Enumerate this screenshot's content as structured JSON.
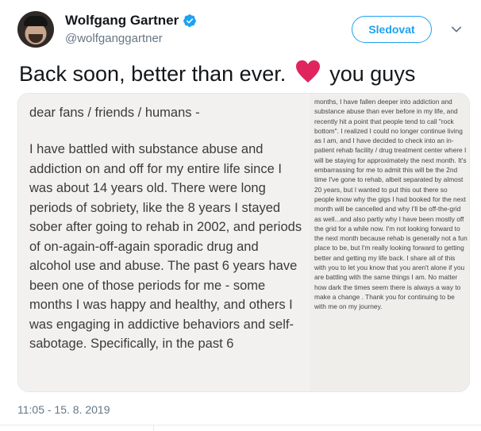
{
  "user": {
    "name": "Wolfgang Gartner",
    "handle": "@wolfganggartner",
    "follow_label": "Sledovat"
  },
  "tweet": {
    "text_before": "Back soon, better than ever.",
    "text_after": "you guys",
    "heart_color": "#e0245e",
    "timestamp": "11:05 - 15. 8. 2019"
  },
  "media": {
    "left_greeting": "dear fans / friends / humans -",
    "left_body": "I have battled with substance abuse and addiction on and off for my entire life since I was about 14 years old.  There were long periods of sobriety, like the 8 years I stayed sober after going to rehab in 2002, and periods of on-again-off-again sporadic drug and alcohol use and abuse. The past 6 years have been one of those periods for me - some months I was happy and healthy, and others I was engaging in addictive behaviors and self-sabotage. Specifically, in the past 6",
    "right_body": "months, I have fallen deeper into addiction and substance abuse than ever before in my life, and recently hit a point that people tend to call \"rock bottom\". I realized I could no longer continue living as I am, and I have decided to check into an in-patient rehab facility / drug treatment center where I will be staying for approximately the next month.  It's embarrassing for me to admit this will be the 2nd time I've gone to rehab, albeit separated by almost 20 years, but I wanted to put this out there so people know why the gigs I had booked for the next month will be cancelled and why I'll be off-the-grid as well...and also partly why I have been mostly off the grid for a while now.  I'm not looking forward to the next month because rehab is generally not a fun place to be, but I'm really looking forward to getting better and getting my life back. I share all of this with you to let you know that you aren't alone if you are battling with the same things I am. No matter how dark the times seem there is always a way to make a change . Thank you for continuing to be with me on my journey."
  },
  "colors": {
    "accent": "#1da1f2",
    "secondary_text": "#657786"
  }
}
